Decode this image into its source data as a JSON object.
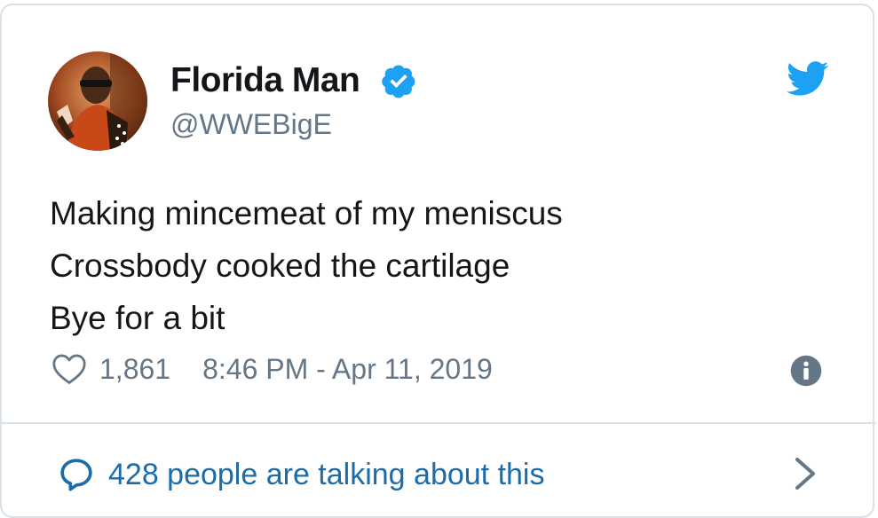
{
  "tweet": {
    "author": {
      "display_name": "Florida Man",
      "handle": "@WWEBigE",
      "verified": true,
      "avatar_icon": "profile-photo"
    },
    "text_lines": [
      "Making mincemeat of my meniscus",
      "Crossbody cooked the cartilage",
      "Bye for a bit"
    ],
    "likes": "1,861",
    "timestamp": "8:46 PM - Apr 11, 2019",
    "talking_about": "428 people are talking about this"
  },
  "icons": {
    "brand": "twitter-bird-icon",
    "verified": "verified-badge-icon",
    "like": "heart-icon",
    "info": "info-icon",
    "reply": "speech-bubble-icon",
    "more": "chevron-right-icon"
  },
  "colors": {
    "brand_blue": "#1da1f2",
    "link_blue": "#1b6ca8",
    "text_primary": "#14171a",
    "text_secondary": "#657786",
    "border": "#d9e1e8"
  }
}
